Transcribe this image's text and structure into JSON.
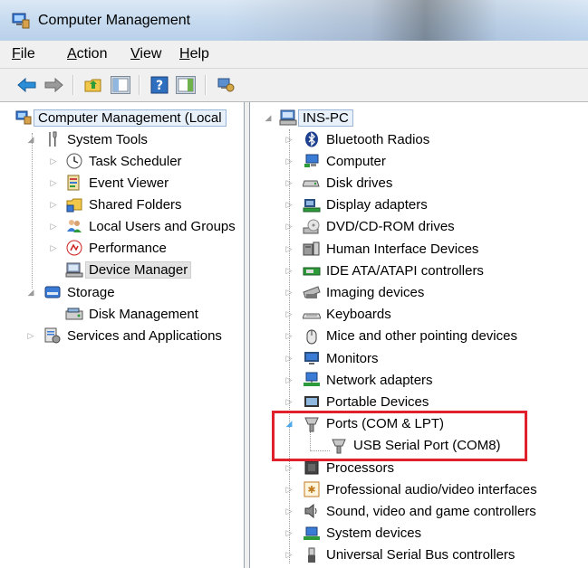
{
  "window": {
    "title": "Computer Management"
  },
  "menu": {
    "items": [
      {
        "key": "F",
        "rest": "ile"
      },
      {
        "key": "A",
        "rest": "ction"
      },
      {
        "key": "V",
        "rest": "iew"
      },
      {
        "key": "H",
        "rest": "elp"
      }
    ]
  },
  "toolbar": {
    "icons": [
      "back-arrow-icon",
      "forward-arrow-icon",
      "up-folder-icon",
      "show-hide-console-tree-icon",
      "help-icon",
      "show-action-pane-icon",
      "properties-icon"
    ]
  },
  "left_tree": {
    "root": "Computer Management (Local",
    "system_tools": "System Tools",
    "task_scheduler": "Task Scheduler",
    "event_viewer": "Event Viewer",
    "shared_folders": "Shared Folders",
    "local_users": "Local Users and Groups",
    "performance": "Performance",
    "device_manager": "Device Manager",
    "storage": "Storage",
    "disk_management": "Disk Management",
    "services": "Services and Applications"
  },
  "device_tree": {
    "root": "INS-PC",
    "items": [
      "Bluetooth Radios",
      "Computer",
      "Disk drives",
      "Display adapters",
      "DVD/CD-ROM drives",
      "Human Interface Devices",
      "IDE ATA/ATAPI controllers",
      "Imaging devices",
      "Keyboards",
      "Mice and other pointing devices",
      "Monitors",
      "Network adapters",
      "Portable Devices",
      "Ports (COM & LPT)",
      "USB Serial Port (COM8)",
      "Processors",
      "Professional audio/video interfaces",
      "Sound, video and game controllers",
      "System devices",
      "Universal Serial Bus controllers"
    ]
  },
  "colors": {
    "highlight": "#e0202a",
    "titlebar": "#c7dbef",
    "menubar": "#f0f0f0"
  }
}
